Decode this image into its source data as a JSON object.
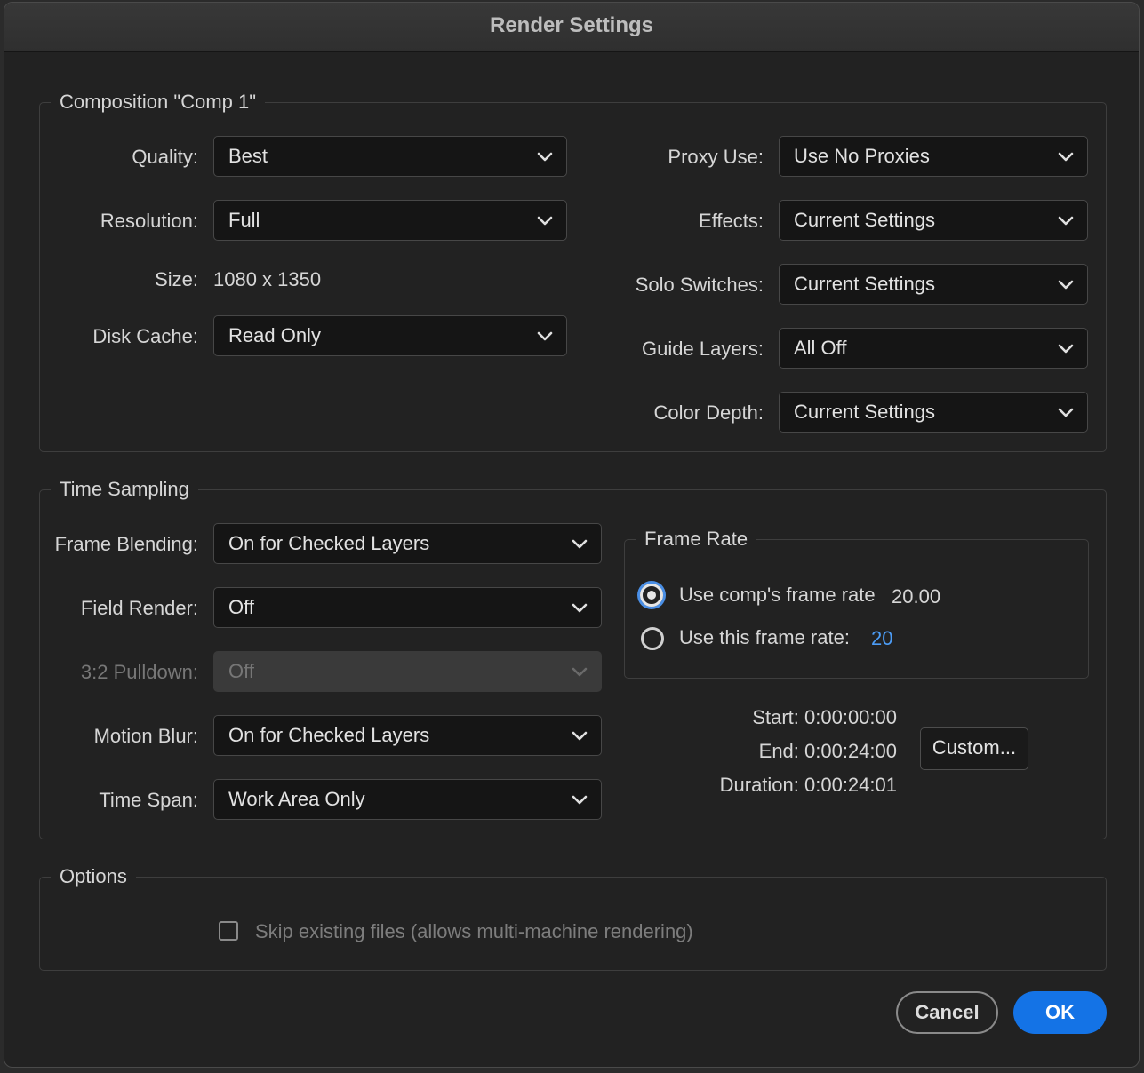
{
  "window": {
    "title": "Render Settings"
  },
  "composition": {
    "legend": "Composition \"Comp 1\"",
    "quality": {
      "label": "Quality:",
      "value": "Best"
    },
    "resolution": {
      "label": "Resolution:",
      "value": "Full"
    },
    "size": {
      "label": "Size:",
      "value": "1080 x 1350"
    },
    "disk_cache": {
      "label": "Disk Cache:",
      "value": "Read Only"
    },
    "proxy_use": {
      "label": "Proxy Use:",
      "value": "Use No Proxies"
    },
    "effects": {
      "label": "Effects:",
      "value": "Current Settings"
    },
    "solo_switches": {
      "label": "Solo Switches:",
      "value": "Current Settings"
    },
    "guide_layers": {
      "label": "Guide Layers:",
      "value": "All Off"
    },
    "color_depth": {
      "label": "Color Depth:",
      "value": "Current Settings"
    }
  },
  "time_sampling": {
    "legend": "Time Sampling",
    "frame_blending": {
      "label": "Frame Blending:",
      "value": "On for Checked Layers"
    },
    "field_render": {
      "label": "Field Render:",
      "value": "Off"
    },
    "pulldown": {
      "label": "3:2 Pulldown:",
      "value": "Off",
      "disabled": true
    },
    "motion_blur": {
      "label": "Motion Blur:",
      "value": "On for Checked Layers"
    },
    "time_span": {
      "label": "Time Span:",
      "value": "Work Area Only"
    },
    "frame_rate": {
      "legend": "Frame Rate",
      "use_comp_label": "Use comp's frame rate",
      "use_comp_value": "20.00",
      "use_comp_selected": true,
      "use_this_label": "Use this frame rate:",
      "use_this_value": "20",
      "use_this_selected": false
    },
    "start": "Start: 0:00:00:00",
    "end": "End: 0:00:24:00",
    "duration": "Duration: 0:00:24:01",
    "custom_button": "Custom..."
  },
  "options": {
    "legend": "Options",
    "skip_existing": {
      "label": "Skip existing files (allows multi-machine rendering)",
      "checked": false
    }
  },
  "buttons": {
    "cancel": "Cancel",
    "ok": "OK"
  },
  "colors": {
    "accent": "#1473e6",
    "link": "#4c9cf5",
    "background": "#222222"
  }
}
